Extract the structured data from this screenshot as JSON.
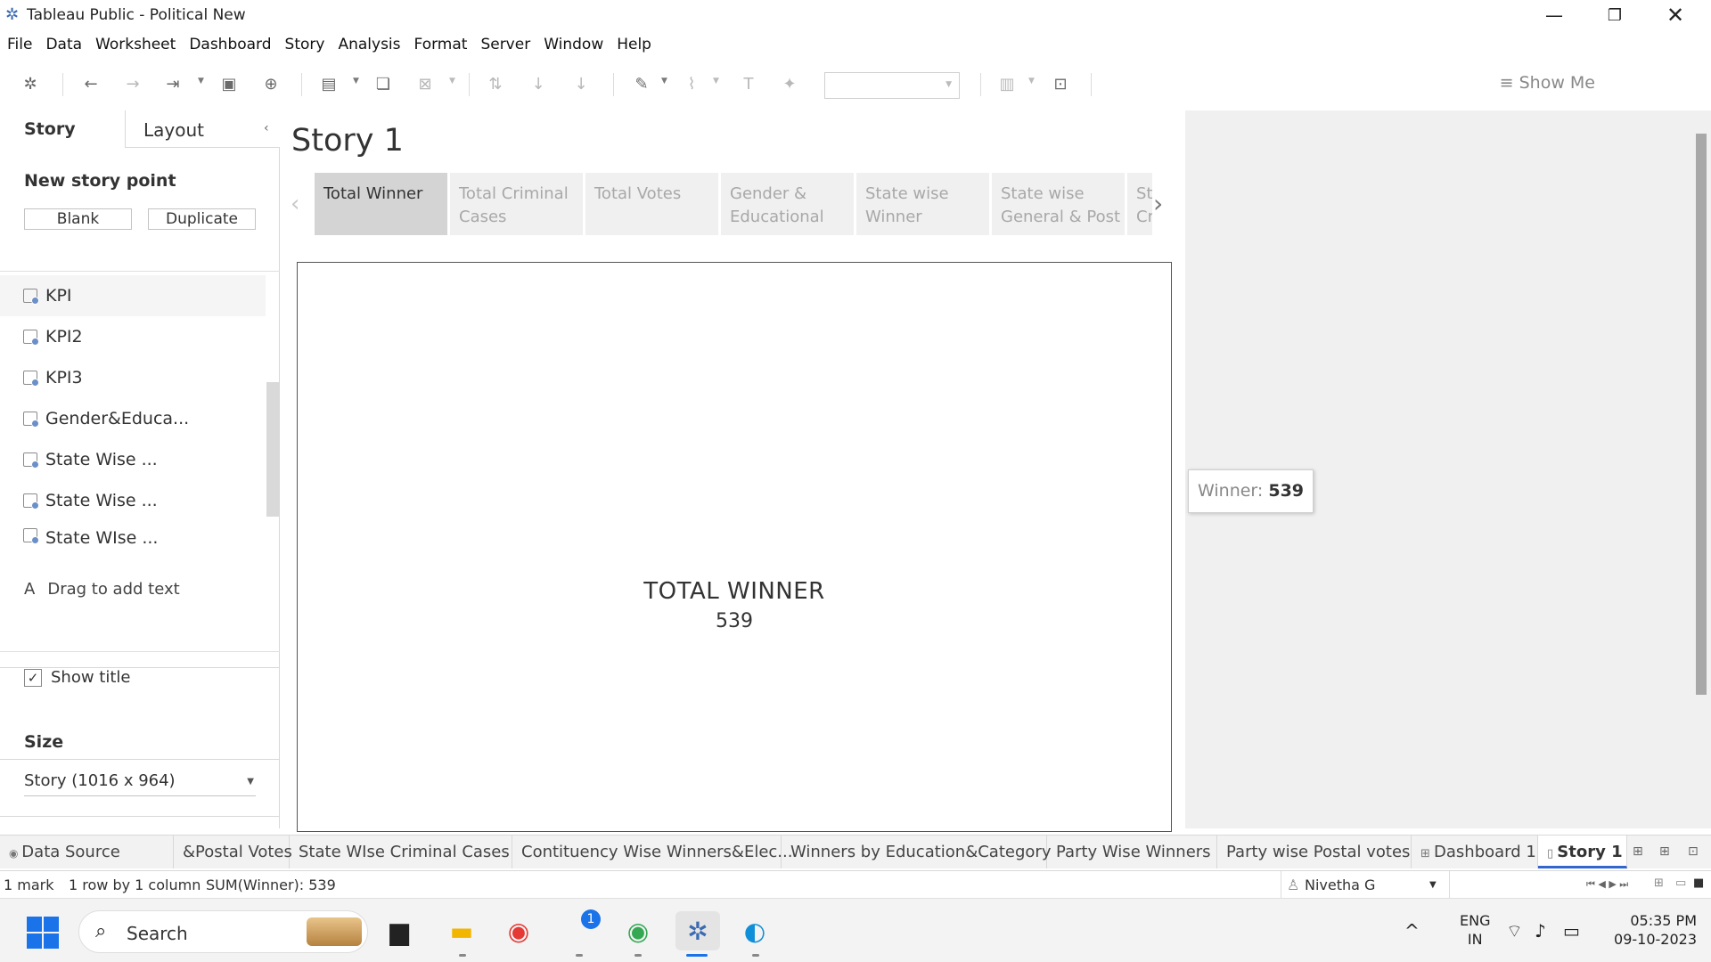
{
  "window": {
    "title": "Tableau Public - Political New",
    "app_icon": "tableau-icon"
  },
  "menu": [
    "File",
    "Data",
    "Worksheet",
    "Dashboard",
    "Story",
    "Analysis",
    "Format",
    "Server",
    "Window",
    "Help"
  ],
  "toolbar": {
    "show_me": "Show Me"
  },
  "left_panel": {
    "tabs": {
      "story": "Story",
      "layout": "Layout"
    },
    "new_story_point": "New story point",
    "blank": "Blank",
    "duplicate": "Duplicate",
    "sheets": [
      "KPI",
      "KPI2",
      "KPI3",
      "Gender&Educa...",
      "State Wise ...",
      "State Wise ...",
      "State WIse ..."
    ],
    "drag_text_icon": "A",
    "drag_text": "Drag to add text",
    "show_title": "Show title",
    "show_title_checked": true,
    "size_label": "Size",
    "size_value": "Story (1016 x 964)"
  },
  "story": {
    "title": "Story 1",
    "points": [
      {
        "label": "Total Winner"
      },
      {
        "label": "Total Criminal Cases"
      },
      {
        "label": "Total Votes"
      },
      {
        "label": "Gender & Educational"
      },
      {
        "label": "State wise Winner"
      },
      {
        "label": "State wise General & Post"
      },
      {
        "label": "State wise Criminal"
      }
    ],
    "active_point": 0,
    "kpi_label": "TOTAL WINNER",
    "kpi_value": "539"
  },
  "tooltip": {
    "label": "Winner:",
    "value": "539"
  },
  "sheet_tabs": {
    "data_source": "Data Source",
    "tabs": [
      "&Postal Votes",
      "State WIse Criminal Cases",
      "Contituency Wise Winners&Elec...",
      "Winners by Education&Category",
      "Party Wise Winners",
      "Party wise Postal votes",
      "Dashboard 1",
      "Story 1"
    ],
    "active": "Story 1"
  },
  "status": {
    "marks": "1 mark",
    "dims": "1 row by 1 column",
    "sum": "SUM(Winner): 539",
    "user": "Nivetha G"
  },
  "taskbar": {
    "search": "Search",
    "lang_line1": "ENG",
    "lang_line2": "IN",
    "time": "05:35 PM",
    "date": "09-10-2023",
    "chrome_badge": "1"
  },
  "colors": {
    "accent": "#3366cc",
    "windows_blue": "#1a73e8"
  }
}
